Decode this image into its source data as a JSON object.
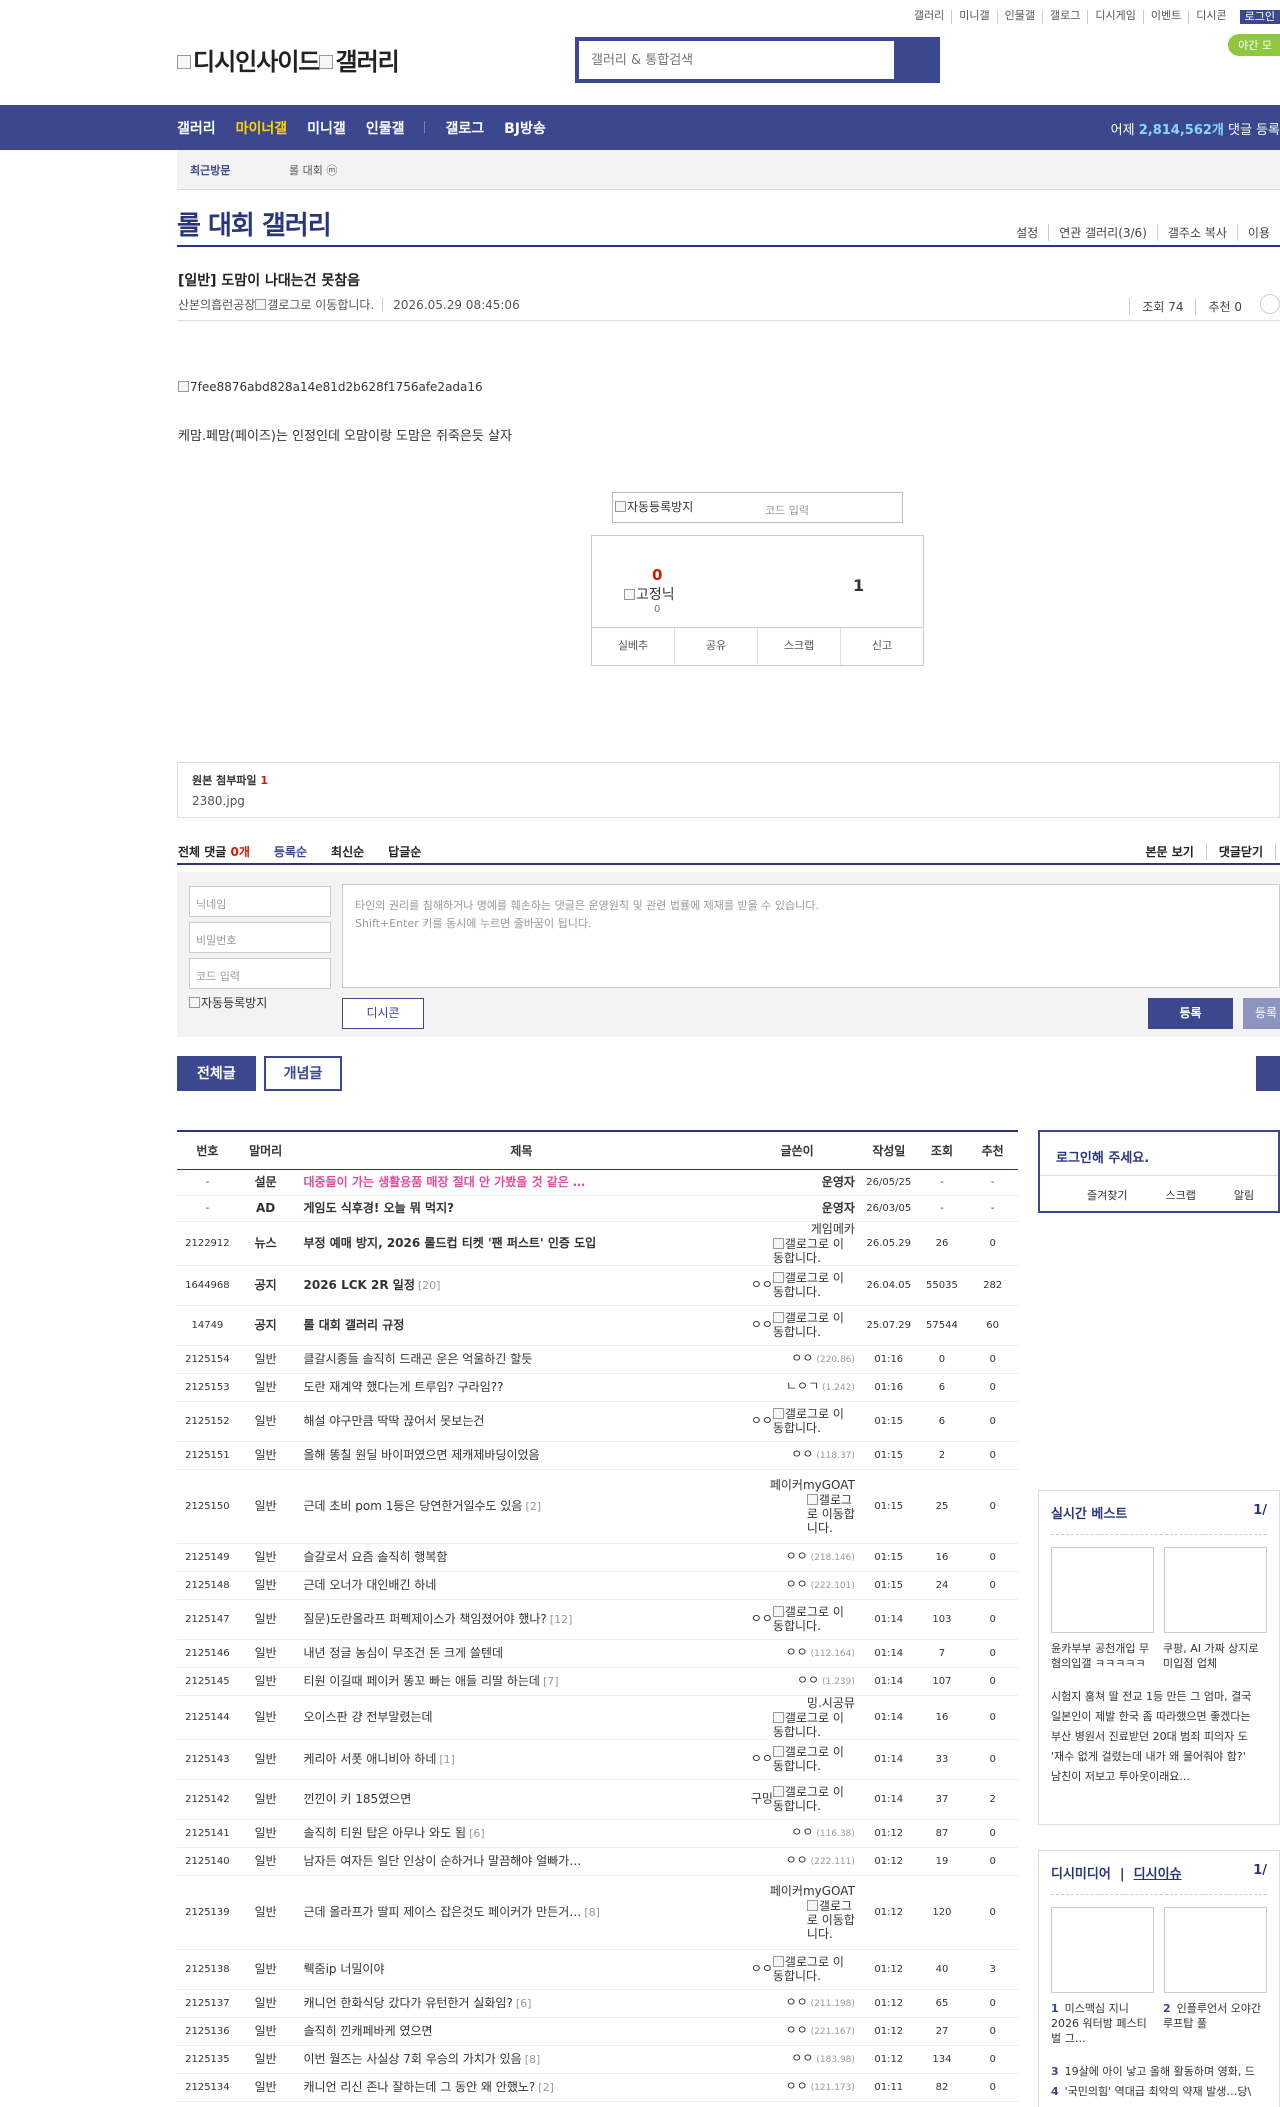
{
  "top_links": [
    "갤러리",
    "미니갤",
    "인물갤",
    "갤로그",
    "디시게임",
    "이벤트",
    "디시콘"
  ],
  "login_label": "로그인",
  "night_label": "야간 모",
  "logo_alt": "디시인사이드",
  "logo_alt2": "갤러리",
  "search_placeholder": "갤러리 & 통합검색",
  "nav": {
    "items": [
      "갤러리",
      "마이너갤",
      "미니갤",
      "인물갤"
    ],
    "items2": [
      "갤로그",
      "BJ방송"
    ],
    "counter_prefix": "어제 ",
    "counter_value": "2,814,562개",
    "counter_suffix": " 댓글 등록"
  },
  "recent": {
    "label": "최근방문",
    "item": "롤 대회 ⓜ"
  },
  "gallery_title": "롤 대회 갤러리",
  "gallery_menu": [
    "설정",
    "연관 갤러리(3/6)",
    "갤주소 복사",
    "이용"
  ],
  "post": {
    "title": "[일반] 도맘이 나대는건 못참음",
    "author": "산본의흡런공장",
    "author_badge_alt": "갤로그로 이동합니다.",
    "date": "2026.05.29 08:45:06",
    "views": "조회 74",
    "recommend": "추천 0",
    "image_alt": "7fee8876abd828a14e81d2b628f1756afe2ada16",
    "body": "케맘.페맘(페이즈)는 인정인데 오맘이랑 도맘은 쥐죽은듯 살자"
  },
  "captcha_alt": "자동등록방지",
  "captcha_placeholder": "코드 입력",
  "vote": {
    "up": "0",
    "fix_alt": "고정닉",
    "fix_count": "0",
    "down": "1",
    "buttons": [
      "실베추",
      "공유",
      "스크랩",
      "신고"
    ]
  },
  "attach": {
    "label": "원본 첨부파일",
    "count": "1",
    "file": "2380.jpg"
  },
  "comments": {
    "total_prefix": "전체 댓글 ",
    "total_count": "0개",
    "sorts": [
      "등록순",
      "최신순",
      "답글순"
    ],
    "right": [
      "본문 보기",
      "댓글닫기"
    ],
    "nick_placeholder": "닉네임",
    "pw_placeholder": "비밀번호",
    "code_placeholder": "코드 입력",
    "captcha_alt": "자동등록방지",
    "textarea_line1": "타인의 권리를 침해하거나 명예를 훼손하는 댓글은 운영원칙 및 관련 법률에 제재를 받을 수 있습니다.",
    "textarea_line2": "Shift+Enter 키를 동시에 누르면 줄바꿈이 됩니다.",
    "dccon": "디시콘",
    "submit": "등록",
    "submit2": "등록"
  },
  "tabs": [
    "전체글",
    "개념글"
  ],
  "table": {
    "headers": [
      "번호",
      "말머리",
      "제목",
      "글쓴이",
      "작성일",
      "조회",
      "추천"
    ],
    "rows": [
      {
        "num": "-",
        "head": "설문",
        "subject": "대중들이 가는 생활용품 매장 절대 안 가봤을 것 같은 …",
        "writer": "운영자",
        "ip": "",
        "date": "26/05/25",
        "view": "-",
        "rec": "-",
        "cls": "pink",
        "wcls": "bold",
        "icon": false,
        "h": 26
      },
      {
        "num": "-",
        "head": "AD",
        "subject": "게임도 식후경! 오늘 뭐 먹지?",
        "writer": "운영자",
        "ip": "",
        "date": "26/03/05",
        "view": "-",
        "rec": "-",
        "cls": "bold",
        "wcls": "bold",
        "icon": false,
        "h": 26
      },
      {
        "num": "2122912",
        "head": "뉴스",
        "subject": "부정 예매 방지, 2026 롤드컵 티켓 '팬 퍼스트' 인증 도입",
        "writer": "게임메카",
        "ip": "",
        "date": "26.05.29",
        "view": "26",
        "rec": "0",
        "cls": "bold",
        "wcls": "",
        "icon": true,
        "h": 40
      },
      {
        "num": "1644968",
        "head": "공지",
        "subject": "2026 LCK 2R 일정",
        "rc": "[20]",
        "writer": "ㅇㅇ",
        "ip": "",
        "date": "26.04.05",
        "view": "55035",
        "rec": "282",
        "cls": "bold",
        "wcls": "",
        "icon": true,
        "h": 40
      },
      {
        "num": "14749",
        "head": "공지",
        "subject": "롤 대회 갤러리 규정",
        "writer": "ㅇㅇ",
        "ip": "",
        "date": "25.07.29",
        "view": "57544",
        "rec": "60",
        "cls": "bold",
        "wcls": "",
        "icon": true,
        "h": 40
      },
      {
        "num": "2125154",
        "head": "일반",
        "subject": "클갈시종들 솔직히 드래곤 운은 억울하긴 할듯",
        "writer": "ㅇㅇ",
        "ip": "(220.86)",
        "date": "01:16",
        "view": "0",
        "rec": "0",
        "cls": "",
        "wcls": "",
        "icon": false,
        "h": 28
      },
      {
        "num": "2125153",
        "head": "일반",
        "subject": "도란 재계약 했다는게 트루임? 구라임??",
        "writer": "ㄴㅇㄱ",
        "ip": "(1.242)",
        "date": "01:16",
        "view": "6",
        "rec": "0",
        "cls": "",
        "wcls": "",
        "icon": false,
        "h": 28
      },
      {
        "num": "2125152",
        "head": "일반",
        "subject": "해설 야구만큼 딱딱 끊어서 못보는건",
        "writer": "ㅇㅇ",
        "ip": "",
        "date": "01:15",
        "view": "6",
        "rec": "0",
        "cls": "",
        "wcls": "",
        "icon": true,
        "h": 40
      },
      {
        "num": "2125151",
        "head": "일반",
        "subject": "올해 똥칠 원딜 바이퍼였으면 제캐제바딩이었음",
        "writer": "ㅇㅇ",
        "ip": "(118.37)",
        "date": "01:15",
        "view": "2",
        "rec": "0",
        "cls": "",
        "wcls": "",
        "icon": false,
        "h": 28
      },
      {
        "num": "2125150",
        "head": "일반",
        "subject": "근데 초비 pom 1등은 당연한거일수도 있음",
        "rc": "[2]",
        "writer": "페이커myGOAT",
        "ip": "",
        "date": "01:15",
        "view": "25",
        "rec": "0",
        "cls": "",
        "wcls": "",
        "icon": true,
        "narrow": true,
        "h": 74
      },
      {
        "num": "2125149",
        "head": "일반",
        "subject": "슬갈로서 요즘 솔직히 행복함",
        "writer": "ㅇㅇ",
        "ip": "(218.146)",
        "date": "01:15",
        "view": "16",
        "rec": "0",
        "cls": "",
        "wcls": "",
        "icon": false,
        "h": 28
      },
      {
        "num": "2125148",
        "head": "일반",
        "subject": "근데 오너가 대인배긴 하네",
        "writer": "ㅇㅇ",
        "ip": "(222.101)",
        "date": "01:15",
        "view": "24",
        "rec": "0",
        "cls": "",
        "wcls": "",
        "icon": false,
        "h": 28
      },
      {
        "num": "2125147",
        "head": "일반",
        "subject": "질문)도란올라프 퍼펙제이스가 책임졌어야 했나?",
        "rc": "[12]",
        "writer": "ㅇㅇ",
        "ip": "",
        "date": "01:14",
        "view": "103",
        "rec": "0",
        "cls": "",
        "wcls": "",
        "icon": true,
        "h": 40
      },
      {
        "num": "2125146",
        "head": "일반",
        "subject": "내년 정글 농심이 무조건 돈 크게 쓸텐데",
        "writer": "ㅇㅇ",
        "ip": "(112.164)",
        "date": "01:14",
        "view": "7",
        "rec": "0",
        "cls": "",
        "wcls": "",
        "icon": false,
        "h": 28
      },
      {
        "num": "2125145",
        "head": "일반",
        "subject": "티원 이길때 페이커 똥꼬 빠는 애들 리딸 하는데",
        "rc": "[7]",
        "writer": "ㅇㅇ",
        "ip": "(1.239)",
        "date": "01:14",
        "view": "107",
        "rec": "0",
        "cls": "",
        "wcls": "",
        "icon": false,
        "h": 28
      },
      {
        "num": "2125144",
        "head": "일반",
        "subject": "오이스판 걍 전부말렸는데",
        "writer": "밍.시공뮤",
        "ip": "",
        "date": "01:14",
        "view": "16",
        "rec": "0",
        "cls": "",
        "wcls": "",
        "icon": true,
        "h": 40
      },
      {
        "num": "2125143",
        "head": "일반",
        "subject": "케리아 서폿 애니비아 하네",
        "rc": "[1]",
        "writer": "ㅇㅇ",
        "ip": "",
        "date": "01:14",
        "view": "33",
        "rec": "0",
        "cls": "",
        "wcls": "",
        "icon": true,
        "h": 40
      },
      {
        "num": "2125142",
        "head": "일반",
        "subject": "낀낀이 키 185였으면",
        "writer": "구밍",
        "ip": "",
        "date": "01:14",
        "view": "37",
        "rec": "2",
        "cls": "",
        "wcls": "",
        "icon": true,
        "h": 40
      },
      {
        "num": "2125141",
        "head": "일반",
        "subject": "솔직히 티원 탑은 아무나 와도 됨",
        "rc": "[6]",
        "writer": "ㅇㅇ",
        "ip": "(116.38)",
        "date": "01:12",
        "view": "87",
        "rec": "0",
        "cls": "",
        "wcls": "",
        "icon": false,
        "h": 28
      },
      {
        "num": "2125140",
        "head": "일반",
        "subject": "남자든 여자든 일단 인상이 순하거나 말끔해야 얼빠가…",
        "writer": "ㅇㅇ",
        "ip": "(222.111)",
        "date": "01:12",
        "view": "19",
        "rec": "0",
        "cls": "",
        "wcls": "",
        "icon": false,
        "h": 28
      },
      {
        "num": "2125139",
        "head": "일반",
        "subject": "근데 올라프가 딸피 제이스 잡은것도 페이커가 만든거…",
        "rc": "[8]",
        "writer": "페이커myGOAT",
        "ip": "",
        "date": "01:12",
        "view": "120",
        "rec": "0",
        "cls": "",
        "wcls": "",
        "icon": true,
        "narrow": true,
        "h": 74
      },
      {
        "num": "2125138",
        "head": "일반",
        "subject": "뤡줌ip 너밀이야",
        "writer": "ㅇㅇ",
        "ip": "",
        "date": "01:12",
        "view": "40",
        "rec": "3",
        "cls": "",
        "wcls": "",
        "icon": true,
        "h": 40
      },
      {
        "num": "2125137",
        "head": "일반",
        "subject": "캐니언 한화식당 갔다가 유턴한거 실화임?",
        "rc": "[6]",
        "writer": "ㅇㅇ",
        "ip": "(211.198)",
        "date": "01:12",
        "view": "65",
        "rec": "0",
        "cls": "",
        "wcls": "",
        "icon": false,
        "h": 28
      },
      {
        "num": "2125136",
        "head": "일반",
        "subject": "솔직히 낀캐페바케 였으면",
        "writer": "ㅇㅇ",
        "ip": "(221.167)",
        "date": "01:12",
        "view": "27",
        "rec": "0",
        "cls": "",
        "wcls": "",
        "icon": false,
        "h": 28
      },
      {
        "num": "2125135",
        "head": "일반",
        "subject": "이번 월즈는 사실상 7회 우승의 가치가 있음",
        "rc": "[8]",
        "writer": "ㅇㅇ",
        "ip": "(183.98)",
        "date": "01:12",
        "view": "134",
        "rec": "0",
        "cls": "",
        "wcls": "",
        "icon": false,
        "h": 28
      },
      {
        "num": "2125134",
        "head": "일반",
        "subject": "캐니언 리신 존나 잘하는데 그 동안 왜 안했노?",
        "rc": "[2]",
        "writer": "ㅇㅇ",
        "ip": "(121.173)",
        "date": "01:11",
        "view": "82",
        "rec": "0",
        "cls": "",
        "wcls": "",
        "icon": false,
        "h": 28
      }
    ],
    "icon_alt": "갤로그로 이동합니다."
  },
  "side": {
    "login_title": "로그인해 주세요.",
    "login_links": [
      "즐겨찾기",
      "스크랩",
      "알림"
    ],
    "best_title": "실시간 베스트",
    "best_page": "1/",
    "best_caps": [
      "윤카부부 공천개입 무혐의입갤 ㅋㅋㅋㅋㅋ",
      "쿠팡, AI 가짜 상지로 미입점 업체"
    ],
    "best_lines": [
      "시험지 훔쳐 딸 전교 1등 만든 그 엄마, 결국",
      "일본인이 제발 한국 좀 따라했으면 좋겠다는",
      "부산 병원서 진료받던 20대 범죄 피의자 도",
      "'재수 없게 걸렸는데 내가 왜 물어줘야 함?'",
      "남친이 저보고 투아웃이래요..."
    ],
    "media_title1": "디시미디어",
    "media_title2": "디시이슈",
    "media_page": "1/",
    "media_caps": [
      [
        "1",
        "미스맥심 지니 2026 워터밤 페스티벌 그…"
      ],
      [
        "2",
        "인플루언서 오야간 루프탑 풀"
      ]
    ],
    "media_lines": [
      [
        "3",
        "19살에 아이 낳고 올해 활동하며 영화, 드"
      ],
      [
        "4",
        "'국민의힘' 역대급 최악의 약재 발생…당\\"
      ]
    ]
  }
}
